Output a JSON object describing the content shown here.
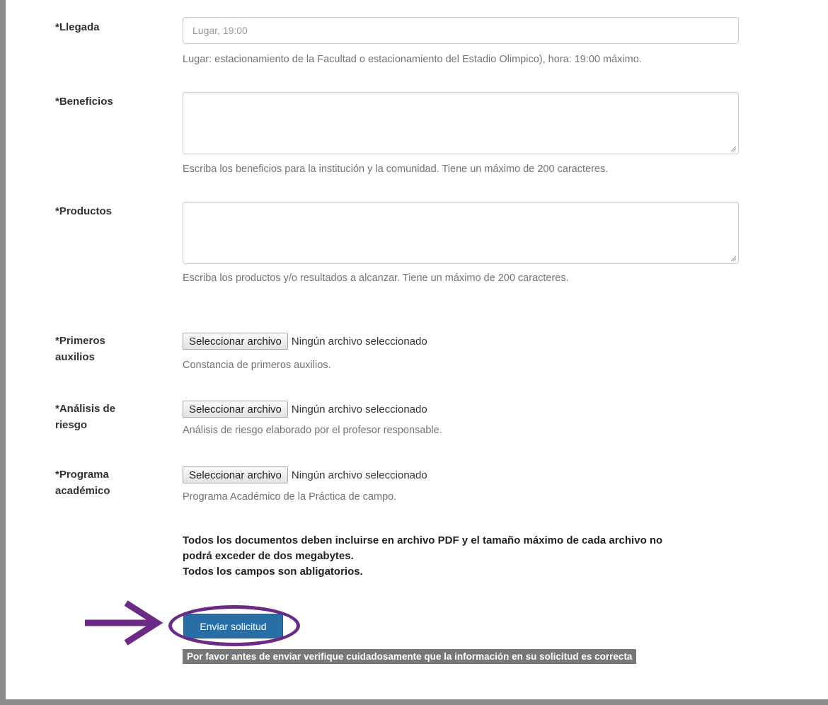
{
  "llegada": {
    "label": "*Llegada",
    "placeholder": "Lugar, 19:00",
    "help": "Lugar: estacionamiento de la Facultad o estacionamiento del Estadio Olimpico), hora: 19:00 máximo."
  },
  "beneficios": {
    "label": "*Beneficios",
    "help": "Escriba los beneficios para la institución y la comunidad. Tiene un máximo de 200 caracteres."
  },
  "productos": {
    "label": "*Productos",
    "help": "Escriba los productos y/o resultados a alcanzar. Tiene un máximo de 200 caracteres."
  },
  "primeros_auxilios": {
    "label_line1": "*Primeros",
    "label_line2": "auxilios",
    "button": "Seleccionar archivo",
    "status": "Ningún archivo seleccionado",
    "help": "Constancia de primeros auxilios."
  },
  "analisis_riesgo": {
    "label_line1": "*Análisis de",
    "label_line2": "riesgo",
    "button": "Seleccionar archivo",
    "status": "Ningún archivo seleccionado",
    "help": "Análisis de riesgo elaborado por el profesor responsable."
  },
  "programa_academico": {
    "label_line1": "*Programa",
    "label_line2": "académico",
    "button": "Seleccionar archivo",
    "status": "Ningún archivo seleccionado",
    "help": "Programa Académico de la Práctica de campo."
  },
  "notice": {
    "line1": "Todos los documentos deben incluirse en archivo PDF y el tamaño máximo de cada archivo no",
    "line2": "podrá exceder de dos megabytes.",
    "line3": "Todos los campos son abligatorios."
  },
  "submit": {
    "label": "Enviar solicitud"
  },
  "warning": "Por favor antes de enviar verifique cuidadosamente que la información en su solicitud es correcta",
  "colors": {
    "annotation": "#6b2a86",
    "submit_bg": "#2a6ea6",
    "warning_bg": "#777777",
    "frame": "#8c8c8c"
  }
}
